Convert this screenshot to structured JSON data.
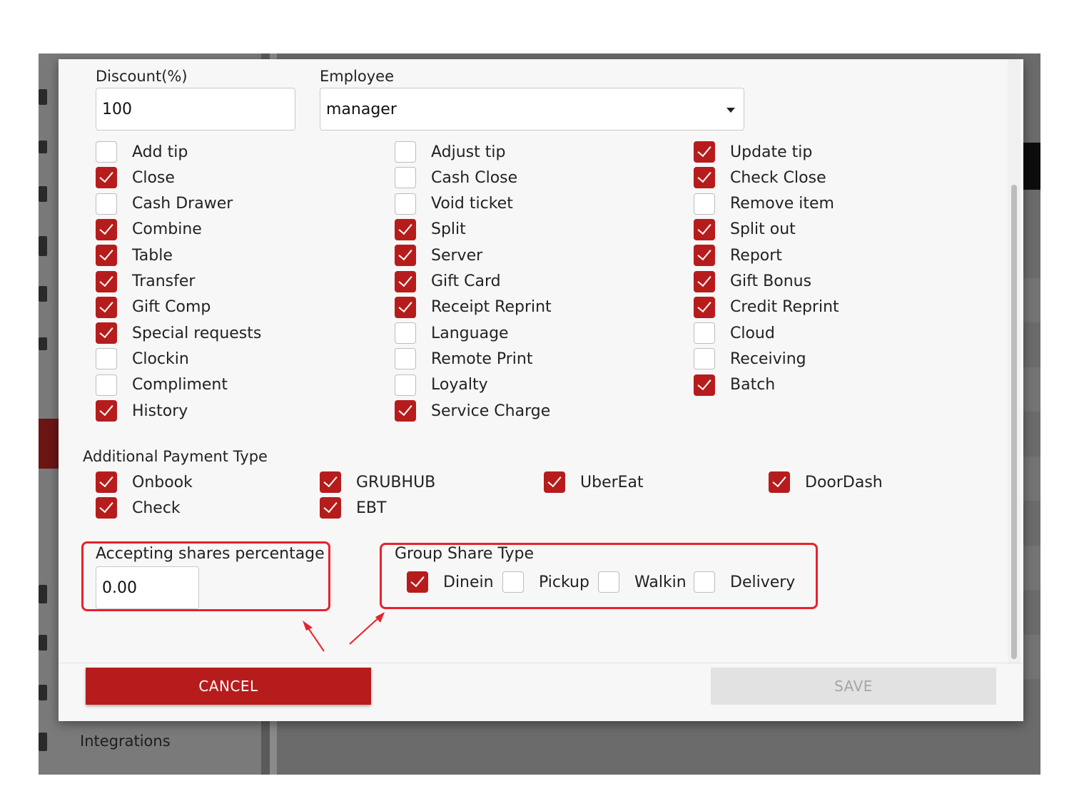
{
  "background": {
    "sidebar_item_label": "Integrations"
  },
  "form": {
    "discount": {
      "label": "Discount(%)",
      "value": "100"
    },
    "employee": {
      "label": "Employee",
      "value": "manager"
    }
  },
  "permissions": {
    "col1": [
      {
        "label": "Add tip",
        "checked": false
      },
      {
        "label": "Close",
        "checked": true
      },
      {
        "label": "Cash Drawer",
        "checked": false
      },
      {
        "label": "Combine",
        "checked": true
      },
      {
        "label": "Table",
        "checked": true
      },
      {
        "label": "Transfer",
        "checked": true
      },
      {
        "label": "Gift Comp",
        "checked": true
      },
      {
        "label": "Special requests",
        "checked": true
      },
      {
        "label": "Clockin",
        "checked": false
      },
      {
        "label": "Compliment",
        "checked": false
      },
      {
        "label": "History",
        "checked": true
      }
    ],
    "col2": [
      {
        "label": "Adjust tip",
        "checked": false
      },
      {
        "label": "Cash Close",
        "checked": false
      },
      {
        "label": "Void ticket",
        "checked": false
      },
      {
        "label": "Split",
        "checked": true
      },
      {
        "label": "Server",
        "checked": true
      },
      {
        "label": "Gift Card",
        "checked": true
      },
      {
        "label": "Receipt Reprint",
        "checked": true
      },
      {
        "label": "Language",
        "checked": false
      },
      {
        "label": "Remote Print",
        "checked": false
      },
      {
        "label": "Loyalty",
        "checked": false
      },
      {
        "label": "Service Charge",
        "checked": true
      }
    ],
    "col3": [
      {
        "label": "Update tip",
        "checked": true
      },
      {
        "label": "Check Close",
        "checked": true
      },
      {
        "label": "Remove item",
        "checked": false
      },
      {
        "label": "Split out",
        "checked": true
      },
      {
        "label": "Report",
        "checked": true
      },
      {
        "label": "Gift Bonus",
        "checked": true
      },
      {
        "label": "Credit Reprint",
        "checked": true
      },
      {
        "label": "Cloud",
        "checked": false
      },
      {
        "label": "Receiving",
        "checked": false
      },
      {
        "label": "Batch",
        "checked": true
      }
    ]
  },
  "additional_payment": {
    "title": "Additional Payment Type",
    "items": [
      {
        "label": "Onbook",
        "checked": true
      },
      {
        "label": "GRUBHUB",
        "checked": true
      },
      {
        "label": "UberEat",
        "checked": true
      },
      {
        "label": "DoorDash",
        "checked": true
      },
      {
        "label": "Check",
        "checked": true
      },
      {
        "label": "EBT",
        "checked": true
      }
    ]
  },
  "shares": {
    "label": "Accepting shares percentage",
    "value": "0.00"
  },
  "group_share": {
    "title": "Group Share Type",
    "items": [
      {
        "label": "Dinein",
        "checked": true
      },
      {
        "label": "Pickup",
        "checked": false
      },
      {
        "label": "Walkin",
        "checked": false
      },
      {
        "label": "Delivery",
        "checked": false
      }
    ]
  },
  "actions": {
    "cancel": "CANCEL",
    "save": "SAVE"
  },
  "colors": {
    "accent": "#b71c1c",
    "highlight": "#e8222b"
  }
}
